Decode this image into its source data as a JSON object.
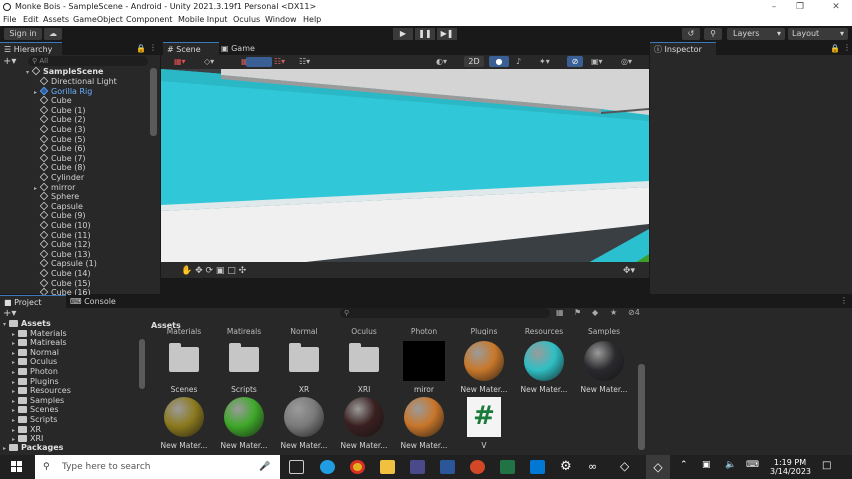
{
  "window": {
    "title": "Monke Bois - SampleScene - Android - Unity 2021.3.19f1 Personal <DX11>"
  },
  "menu": [
    "File",
    "Edit",
    "Assets",
    "GameObject",
    "Component",
    "Mobile Input",
    "Oculus",
    "Window",
    "Help"
  ],
  "toolbar": {
    "sign_in": "Sign in",
    "layers": "Layers",
    "layout": "Layout"
  },
  "hierarchy": {
    "tab": "Hierarchy",
    "search_placeholder": "All",
    "scene": "SampleScene",
    "items": [
      "Directional Light",
      "Gorilla Rig",
      "Cube",
      "Cube (1)",
      "Cube (2)",
      "Cube (3)",
      "Cube (5)",
      "Cube (6)",
      "Cube (7)",
      "Cube (8)",
      "Cylinder",
      "mirror",
      "Sphere",
      "Capsule",
      "Cube (9)",
      "Cube (10)",
      "Cube (11)",
      "Cube (12)",
      "Cube (13)",
      "Capsule (1)",
      "Cube (14)",
      "Cube (15)",
      "Cube (16)"
    ]
  },
  "scene_tabs": {
    "scene": "Scene",
    "game": "Game"
  },
  "scene_toolbar": {
    "mode_2d": "2D"
  },
  "inspector": {
    "tab": "Inspector"
  },
  "project": {
    "tab_project": "Project",
    "tab_console": "Console",
    "assets_label": "Assets",
    "hidden_count": "4",
    "tree": [
      "Materials",
      "Matireals",
      "Normal",
      "Oculus",
      "Photon",
      "Plugins",
      "Resources",
      "Samples",
      "Scenes",
      "Scripts",
      "XR",
      "XRI"
    ],
    "packages": "Packages",
    "top_row_cut": [
      "Materials",
      "Matireals",
      "Normal",
      "Oculus",
      "Photon",
      "Plugins",
      "Resources",
      "Samples"
    ],
    "row1": [
      "Scenes",
      "Scripts",
      "XR",
      "XRI",
      "miror",
      "New Mater...",
      "New Mater...",
      "New Mater..."
    ],
    "row2": [
      "New Mater...",
      "New Mater...",
      "New Mater...",
      "New Mater...",
      "New Mater...",
      "V"
    ]
  },
  "colors": {
    "row1_spheres": [
      "#c8782a",
      "#2fbfc4",
      "#2a2a2e"
    ],
    "row2_spheres": [
      "#8c7a1e",
      "#3fa82a",
      "#7a7a7a",
      "#3a2020",
      "#c8762a"
    ],
    "sky_wall": "#30c8d8",
    "accent": "#3a79bb"
  },
  "taskbar": {
    "search_placeholder": "Type here to search",
    "time": "1:19 PM",
    "date": "3/14/2023"
  }
}
